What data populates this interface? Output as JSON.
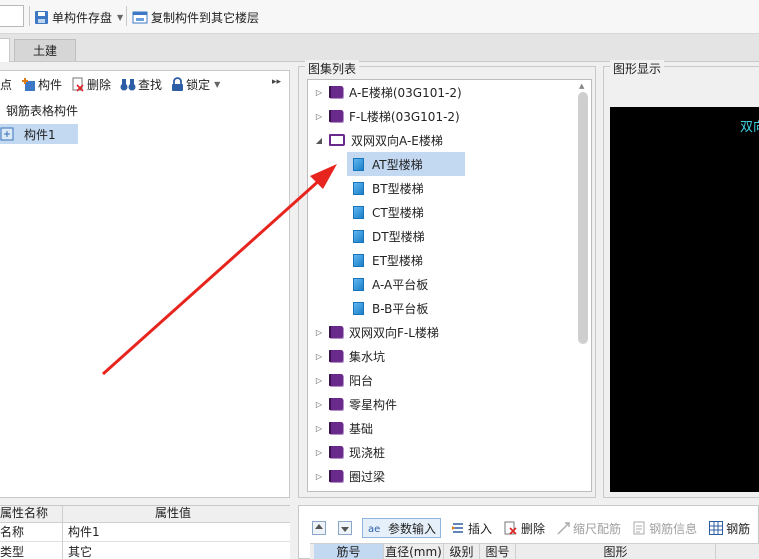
{
  "toolbar": {
    "save_component": "单构件存盘",
    "copy_to_floor": "复制构件到其它楼层"
  },
  "tabs": [
    "土建"
  ],
  "left_panel": {
    "toolbar": [
      "点",
      "构件",
      "删除",
      "查找",
      "锁定"
    ],
    "more": "▸▸",
    "tree_root": "钢筋表格构件",
    "tree_child": "构件1"
  },
  "atlas": {
    "title": "图集列表",
    "items": [
      {
        "label": "A-E楼梯(03G101-2)"
      },
      {
        "label": "F-L楼梯(03G101-2)"
      },
      {
        "label": "双网双向A-E楼梯"
      },
      {
        "label": "AT型楼梯"
      },
      {
        "label": "BT型楼梯"
      },
      {
        "label": "CT型楼梯"
      },
      {
        "label": "DT型楼梯"
      },
      {
        "label": "ET型楼梯"
      },
      {
        "label": "A-A平台板"
      },
      {
        "label": "B-B平台板"
      },
      {
        "label": "双网双向F-L楼梯"
      },
      {
        "label": "集水坑"
      },
      {
        "label": "阳台"
      },
      {
        "label": "零星构件"
      },
      {
        "label": "基础"
      },
      {
        "label": "现浇桩"
      },
      {
        "label": "圈过梁"
      }
    ]
  },
  "graphic": {
    "title": "图形显示",
    "canvas_text": "双向"
  },
  "property_grid": {
    "headers": [
      "属性名称",
      "属性值"
    ],
    "rows": [
      [
        "名称",
        "构件1"
      ],
      [
        "类型",
        "其它"
      ]
    ]
  },
  "rebar": {
    "toolbar": [
      "参数输入",
      "插入",
      "删除",
      "缩尺配筋",
      "钢筋信息",
      "钢筋"
    ],
    "columns": [
      "筋号",
      "直径(mm)",
      "级别",
      "图号",
      "图形"
    ]
  },
  "colors": {
    "accent": "#c3d9f2",
    "book": "#6a2a8c",
    "doc": "#1b7fc8",
    "arrow": "#e8241e",
    "canvas_text": "#3fd0e0"
  }
}
